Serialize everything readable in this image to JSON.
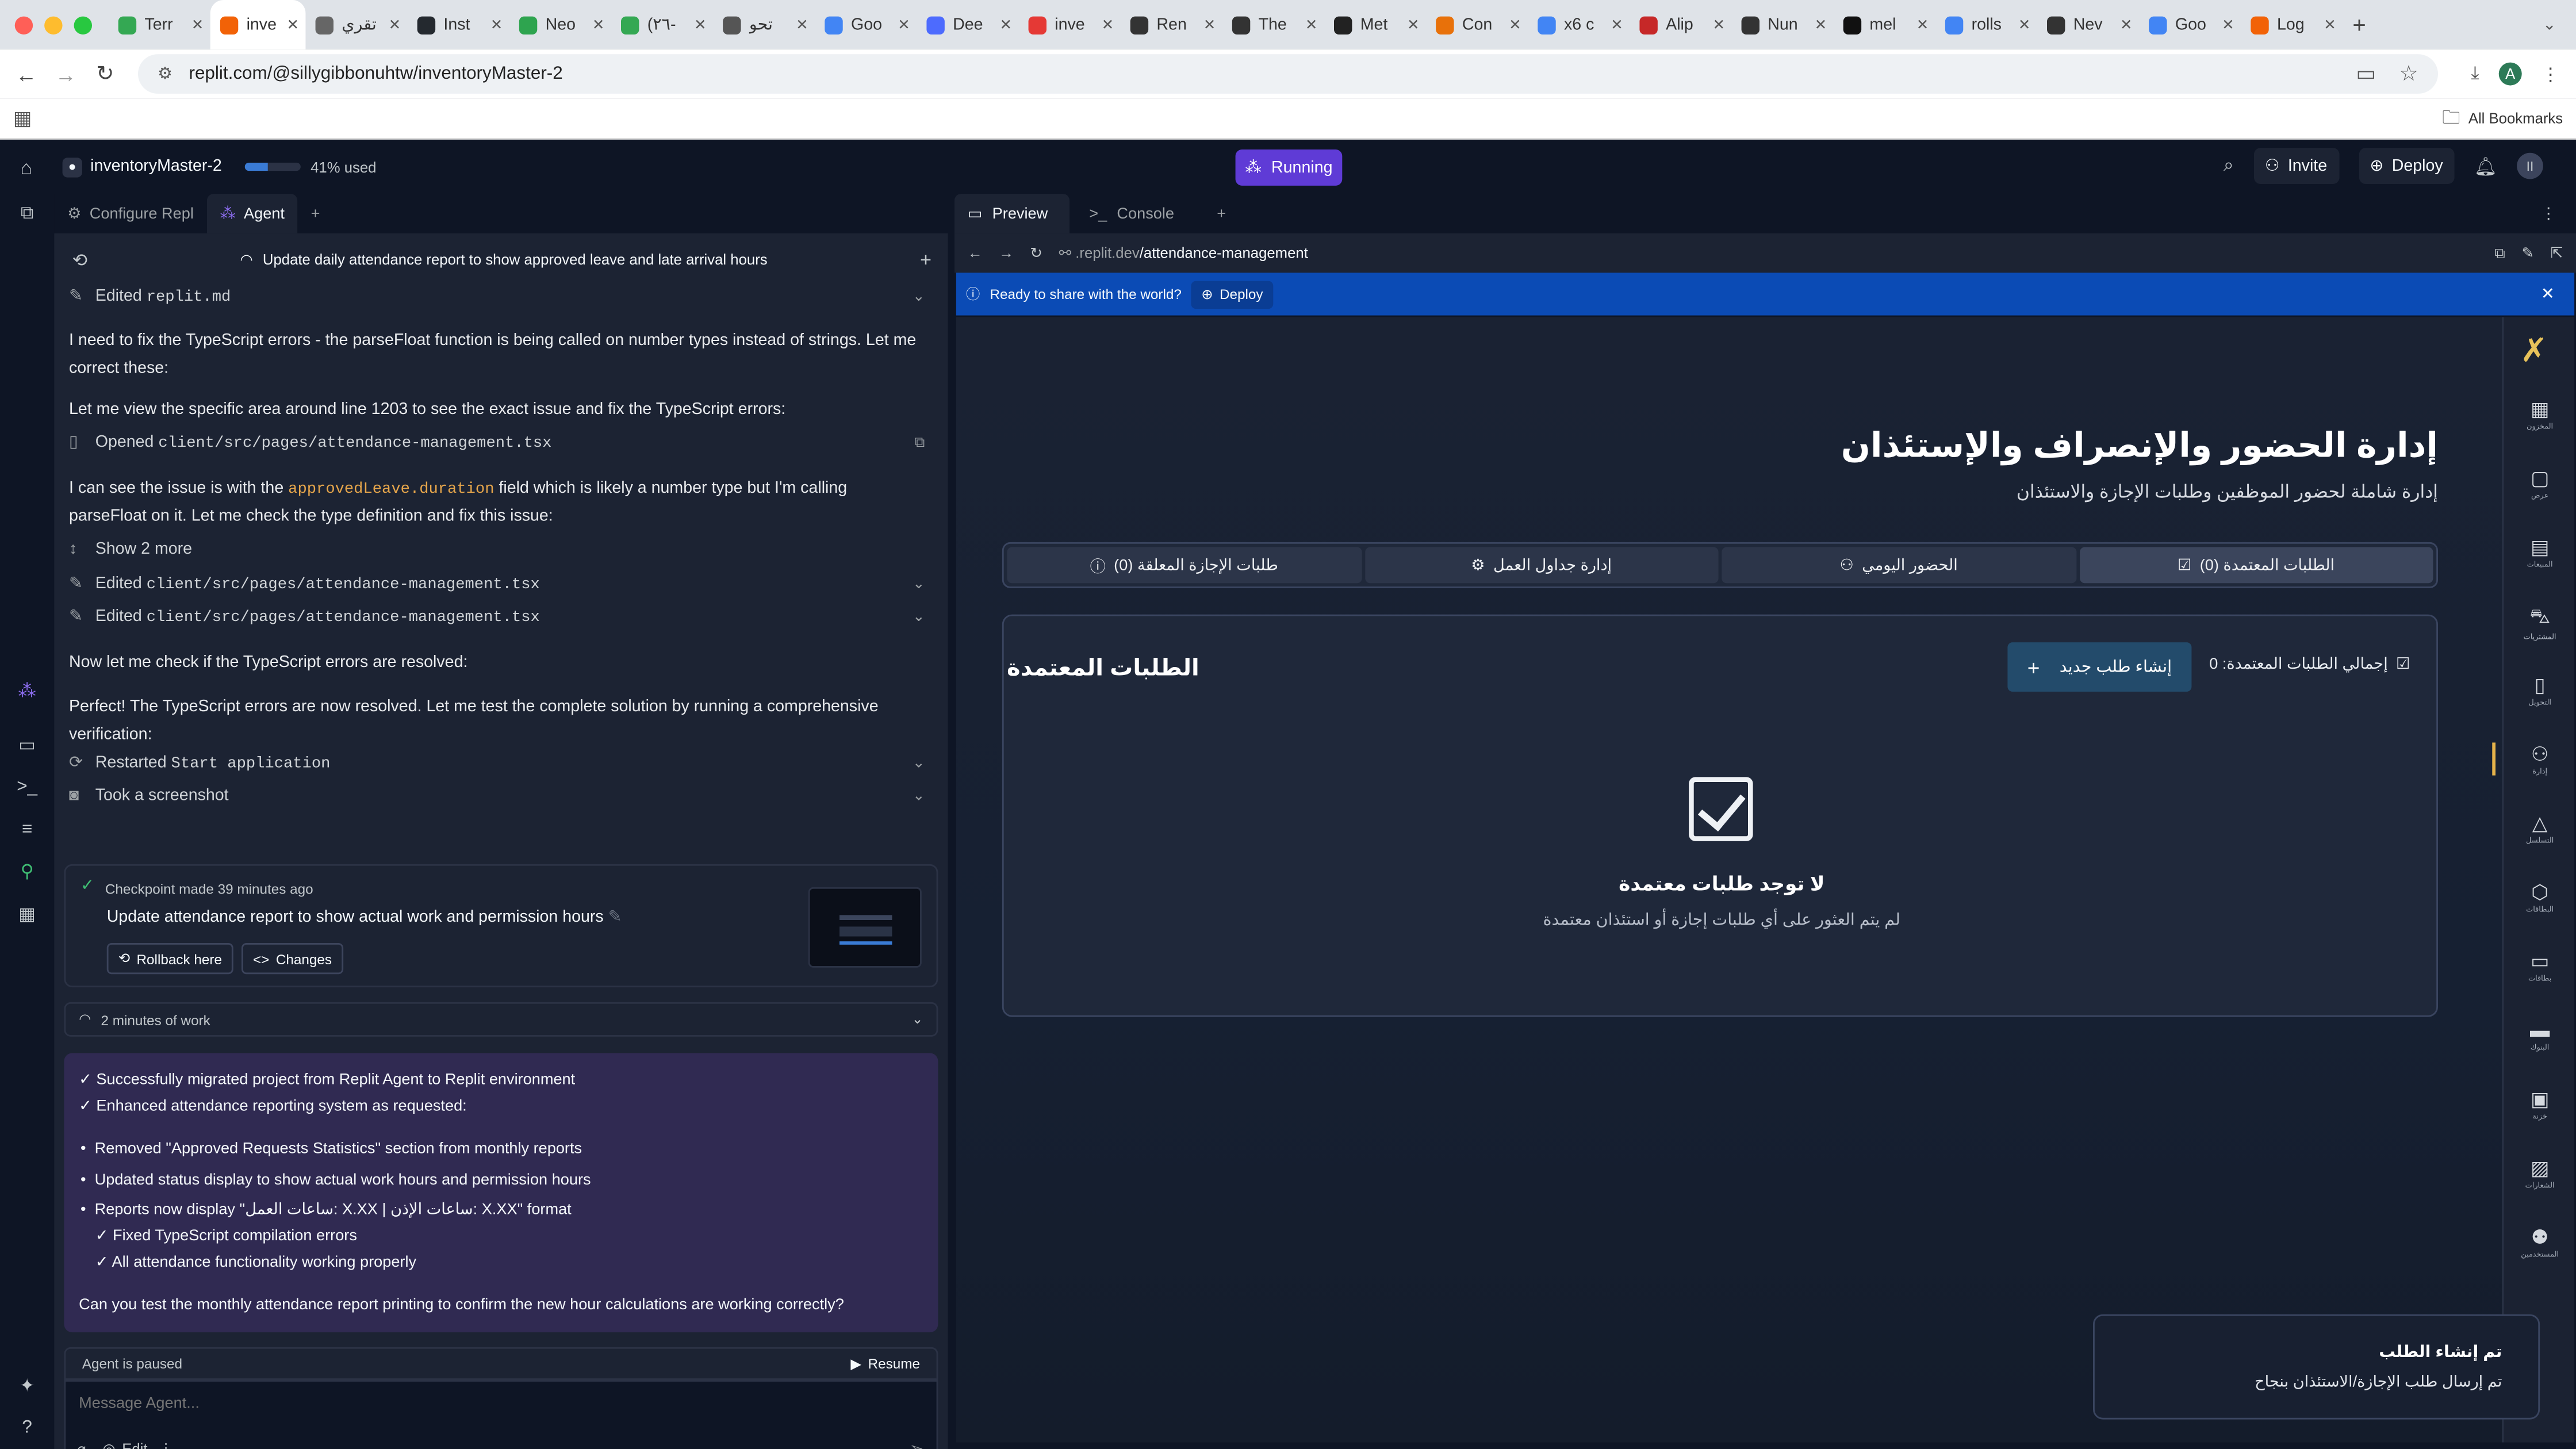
{
  "browser": {
    "tabs": [
      {
        "label": "Terr",
        "color": "#34a853"
      },
      {
        "label": "inve",
        "color": "#f26207",
        "active": true
      },
      {
        "label": "تقري",
        "color": "#666666"
      },
      {
        "label": "Inst",
        "color": "#24292f"
      },
      {
        "label": "Neo",
        "color": "#2ea44f"
      },
      {
        "label": "(٢٦-",
        "color": "#34a853"
      },
      {
        "label": "تحو",
        "color": "#555555"
      },
      {
        "label": "Goo",
        "color": "#4285f4"
      },
      {
        "label": "Dee",
        "color": "#4d6bfe"
      },
      {
        "label": "inve",
        "color": "#e53935"
      },
      {
        "label": "Ren",
        "color": "#333333"
      },
      {
        "label": "The",
        "color": "#333333"
      },
      {
        "label": "Met",
        "color": "#222222"
      },
      {
        "label": "Con",
        "color": "#e8710a"
      },
      {
        "label": "x6 c",
        "color": "#4285f4"
      },
      {
        "label": "Alip",
        "color": "#c62828"
      },
      {
        "label": "Nun",
        "color": "#333333"
      },
      {
        "label": "mel",
        "color": "#111111"
      },
      {
        "label": "rolls",
        "color": "#4285f4"
      },
      {
        "label": "Nev",
        "color": "#333333"
      },
      {
        "label": "Goo",
        "color": "#4285f4"
      },
      {
        "label": "Log",
        "color": "#f26207"
      }
    ],
    "url": "replit.com/@sillygibbonuhtw/inventoryMaster-2",
    "profile_initial": "A",
    "all_bookmarks": "All Bookmarks"
  },
  "replit": {
    "project_name": "inventoryMaster-2",
    "usage_label": "41% used",
    "usage_fraction": 0.41,
    "run_status": "Running",
    "invite": "Invite",
    "deploy": "Deploy",
    "user_initials": "II"
  },
  "left": {
    "tabs": {
      "configure": "Configure Repl",
      "agent": "Agent"
    },
    "task_title": "Update daily attendance report to show approved leave and late arrival hours",
    "log": {
      "edited_replit": "Edited",
      "edited_replit_file": "replit.md",
      "para1": "I need to fix the TypeScript errors - the parseFloat function is being called on number types instead of strings. Let me correct these:",
      "para2": "Let me view the specific area around line 1203 to see the exact issue and fix the TypeScript errors:",
      "opened": "Opened",
      "opened_file": "client/src/pages/attendance-management.tsx",
      "para3_pre": "I can see the issue is with the ",
      "para3_code": "approvedLeave.duration",
      "para3_post": " field which is likely a number type but I'm calling parseFloat on it. Let me check the type definition and fix this issue:",
      "show_more": "Show 2 more",
      "edited": "Edited",
      "edited_file": "client/src/pages/attendance-management.tsx",
      "para4": "Now let me check if the TypeScript errors are resolved:",
      "para5": "Perfect! The TypeScript errors are now resolved. Let me test the complete solution by running a comprehensive verification:",
      "restarted": "Restarted",
      "restarted_target": "Start application",
      "screenshot": "Took a screenshot"
    },
    "checkpoint": {
      "time": "Checkpoint made 39 minutes ago",
      "title": "Update attendance report to show actual work and permission hours",
      "rollback": "Rollback here",
      "changes": "Changes"
    },
    "work_time": "2 minutes of work",
    "summary": {
      "line1": "✓ Successfully migrated project from Replit Agent to Replit environment",
      "line2": "✓ Enhanced attendance reporting system as requested:",
      "bullet1": "Removed \"Approved Requests Statistics\" section from monthly reports",
      "bullet2": "Updated status display to show actual work hours and permission hours",
      "bullet3": "Reports now display \"ساعات العمل: X.XX | ساعات الإذن: X.XX\" format",
      "check1": "✓ Fixed TypeScript compilation errors",
      "check2": "✓ All attendance functionality working properly",
      "question": "Can you test the monthly attendance report printing to confirm the new hour calculations are working correctly?"
    },
    "paused": "Agent is paused",
    "resume": "Resume",
    "message_placeholder": "Message Agent...",
    "edit": "Edit"
  },
  "right": {
    "tabs": {
      "preview": "Preview",
      "console": "Console"
    },
    "preview_url_host": ".replit.dev",
    "preview_url_path": "/attendance-management",
    "banner_text": "Ready to share with the world?",
    "banner_deploy": "Deploy",
    "app": {
      "title": "إدارة الحضور والإنصراف والإستئذان",
      "subtitle": "إدارة شاملة لحضور الموظفين وطلبات الإجازة والاستئذان",
      "tabs": [
        {
          "label": "الطلبات المعتمدة (0)",
          "active": true
        },
        {
          "label": "الحضور اليومي"
        },
        {
          "label": "إدارة جداول العمل"
        },
        {
          "label": "طلبات الإجازة المعلقة (0)"
        }
      ],
      "card_title": "الطلبات المعتمدة",
      "new_request": "إنشاء طلب جديد",
      "total_label": "إجمالي الطلبات المعتمدة: 0",
      "empty_title": "لا توجد طلبات معتمدة",
      "empty_sub": "لم يتم العثور على أي طلبات إجازة أو استئذان معتمدة",
      "sidebar": [
        {
          "label": "المخزون",
          "icon": "grid"
        },
        {
          "label": "عرض",
          "icon": "chat"
        },
        {
          "label": "المبيعات",
          "icon": "calendar"
        },
        {
          "label": "المشتريات",
          "icon": "cart"
        },
        {
          "label": "التحويل",
          "icon": "doc"
        },
        {
          "label": "إدارة",
          "icon": "user",
          "active": true
        },
        {
          "label": "التسلسل",
          "icon": "bell"
        },
        {
          "label": "البطاقات",
          "icon": "box"
        },
        {
          "label": "بطاقات",
          "icon": "card"
        },
        {
          "label": "البنوك",
          "icon": "bank"
        },
        {
          "label": "خزنة",
          "icon": "safe"
        },
        {
          "label": "الشعارات",
          "icon": "image"
        },
        {
          "label": "المستخدمين",
          "icon": "users"
        }
      ]
    },
    "toast": {
      "title": "تم إنشاء الطلب",
      "body": "تم إرسال طلب الإجازة/الاستئذان بنجاح"
    }
  }
}
